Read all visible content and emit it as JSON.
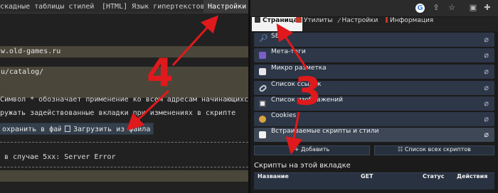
{
  "left": {
    "tabs": [
      {
        "label": "скадные таблицы стилей"
      },
      {
        "label": "[HTML] Язык гипертекстовой разметки"
      },
      {
        "label": "Настройки",
        "active": true
      }
    ],
    "field_domain": "w.old-games.ru",
    "field_path": "u/catalog/",
    "note_line1": "Символ * обозначает применение ко всем адресам начинающихся с указанного",
    "note_line2": "ружать задействованные вкладки при изменениях в скрипте",
    "save_label": "охранить в файл",
    "load_label": "Загрузить из файла",
    "error_text": "в случае 5хх: Server Error"
  },
  "browser": {
    "google_letter": "G"
  },
  "popup": {
    "tabs": [
      {
        "label": "Страница",
        "icon": "page-icon",
        "active": true
      },
      {
        "label": "Утилиты",
        "icon": "toolbox-icon"
      },
      {
        "label": "Настройки",
        "icon": "wrench-icon"
      },
      {
        "label": "Информация",
        "icon": "info-icon"
      }
    ],
    "rows": [
      {
        "label": "SEO",
        "icon": "search-icon"
      },
      {
        "label": "Мета-теги",
        "icon": "meta-icon"
      },
      {
        "label": "Микро разметка",
        "icon": "markup-icon"
      },
      {
        "label": "Список ссылок",
        "icon": "link-icon"
      },
      {
        "label": "Список изображений",
        "icon": "image-icon"
      },
      {
        "label": "Cookies",
        "icon": "cookie-icon"
      },
      {
        "label": "Встраиваемые скрипты и стили",
        "icon": "script-icon",
        "selected": true
      }
    ],
    "add_label": "+ Добавить",
    "all_scripts_label": "Список всех скриптов",
    "scripts_title": "Скрипты на этой вкладке",
    "table_headers": [
      "Название",
      "GET",
      "Статус",
      "Действия"
    ]
  },
  "annotations": {
    "step_left": "4",
    "step_right": "3",
    "color": "#e0191c"
  }
}
